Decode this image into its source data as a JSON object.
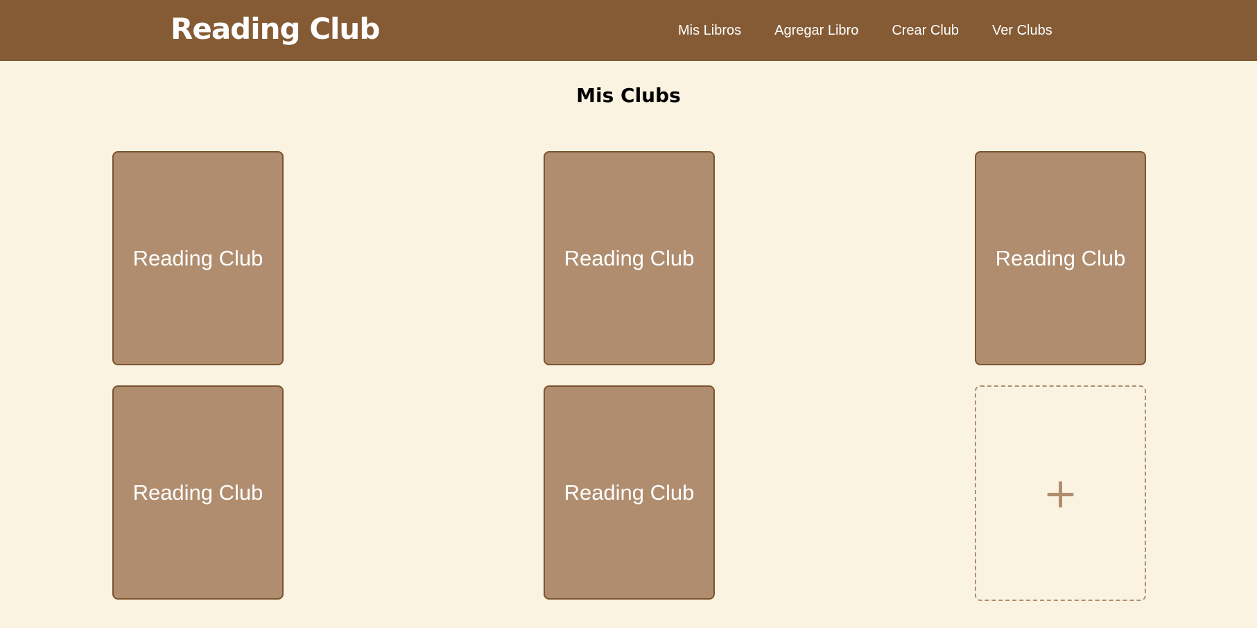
{
  "nav": {
    "brand": "Reading Club",
    "links": [
      "Mis Libros",
      "Agregar Libro",
      "Crear Club",
      "Ver Clubs"
    ]
  },
  "page_title": "Mis Clubs",
  "clubs": [
    {
      "name": "Reading Club"
    },
    {
      "name": "Reading Club"
    },
    {
      "name": "Reading Club"
    },
    {
      "name": "Reading Club"
    },
    {
      "name": "Reading Club"
    }
  ],
  "add_card": {
    "symbol": "+",
    "icon": "plus-icon"
  },
  "colors": {
    "navbar_bg": "#845b34",
    "page_bg": "#faf3e1",
    "card_bg": "#b08d6e",
    "card_border": "#7a5430"
  }
}
